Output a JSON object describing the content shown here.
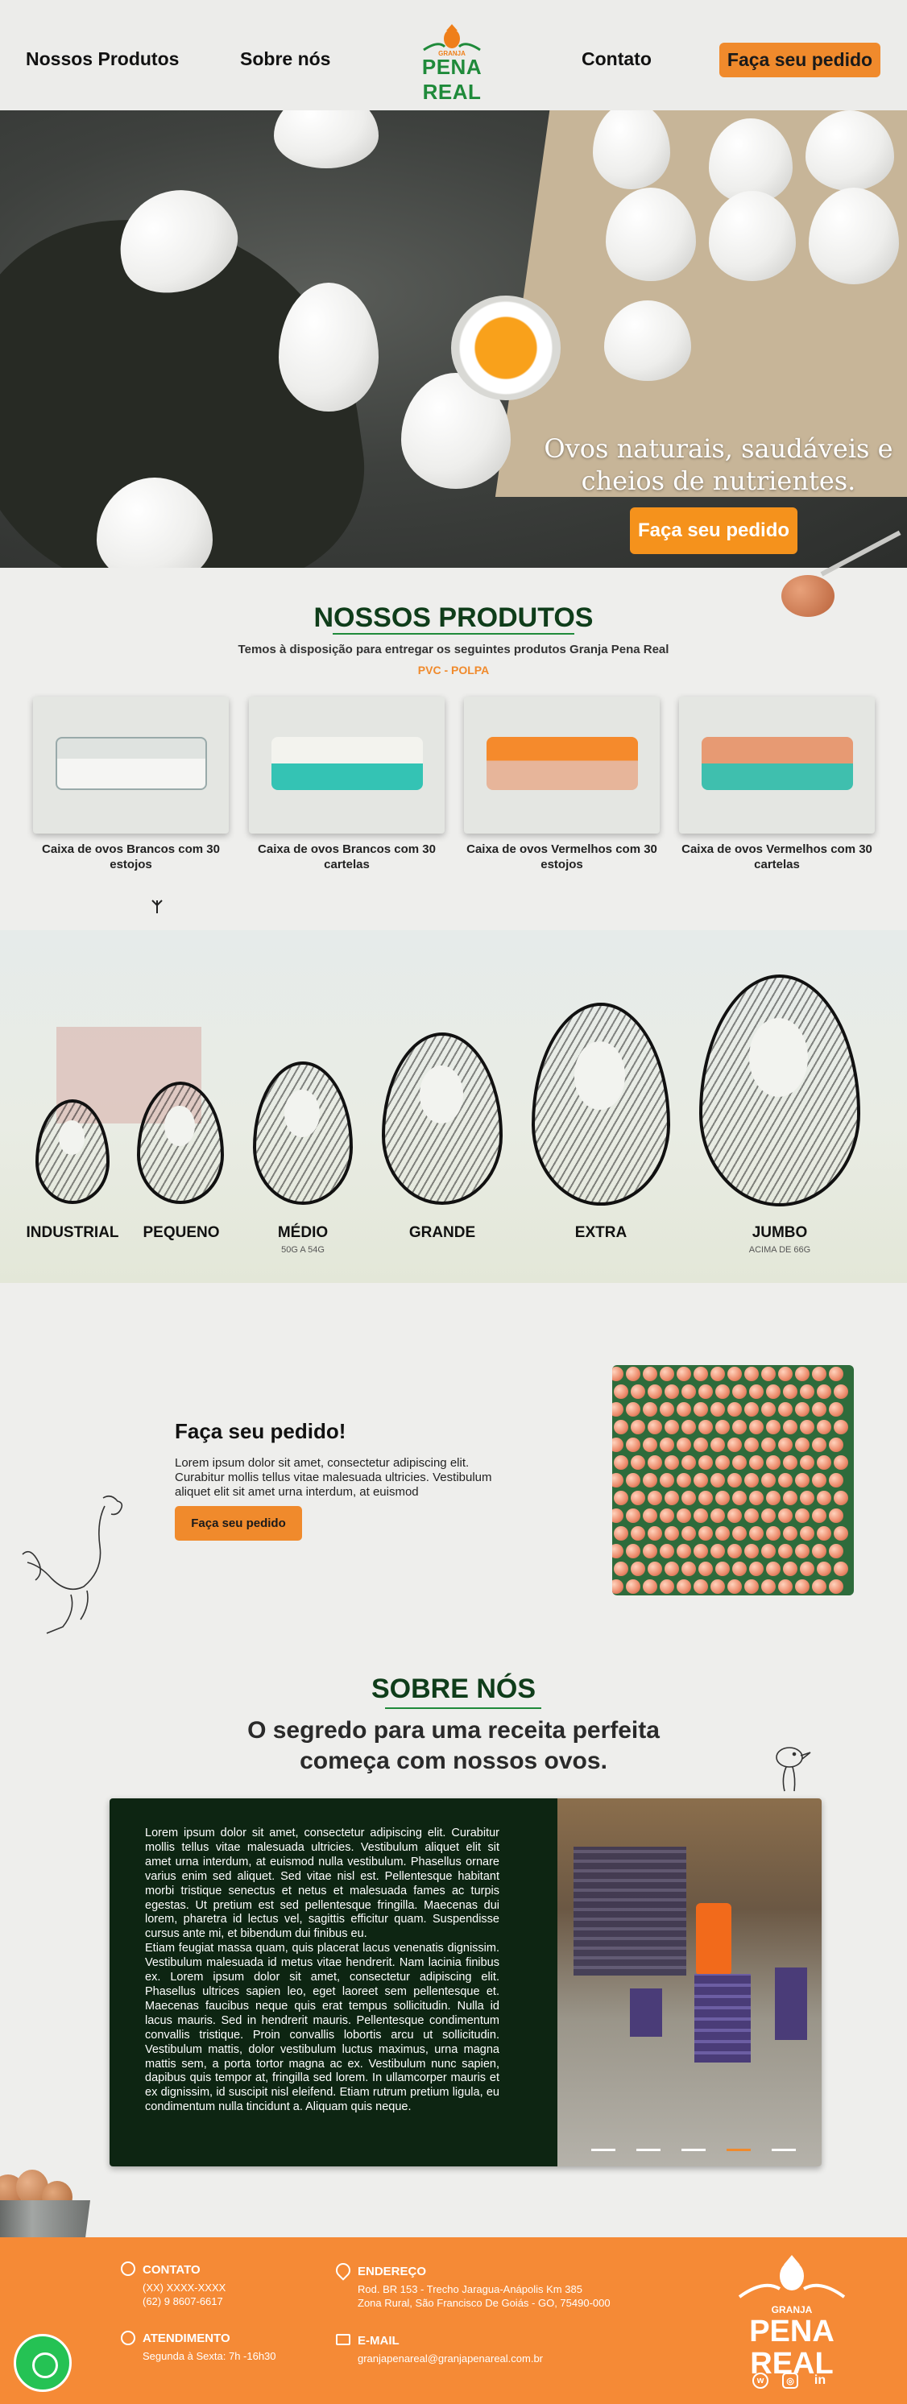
{
  "nav": {
    "produtos": "Nossos Produtos",
    "sobre": "Sobre nós",
    "contato": "Contato",
    "pedido": "Faça seu pedido"
  },
  "logo": {
    "granja": "GRANJA",
    "brand": "PENA REAL"
  },
  "hero": {
    "title": "Ovos naturais, saudáveis e cheios de nutrientes.",
    "button": "Faça seu pedido"
  },
  "produtos": {
    "title": "NOSSOS PRODUTOS",
    "subtitle": "Temos à disposição para entregar os seguintes produtos Granja Pena Real",
    "tag": "PVC - POLPA",
    "items": [
      {
        "label": "Caixa de ovos Brancos com 30 estojos"
      },
      {
        "label": "Caixa de ovos Brancos com 30 cartelas"
      },
      {
        "label": "Caixa de ovos Vermelhos com 30 estojos"
      },
      {
        "label": "Caixa de ovos Vermelhos com 30 cartelas"
      }
    ]
  },
  "tamanhos": [
    {
      "name": "INDUSTRIAL",
      "note": ""
    },
    {
      "name": "PEQUENO",
      "note": ""
    },
    {
      "name": "MÉDIO",
      "note": "50G A 54G"
    },
    {
      "name": "GRANDE",
      "note": ""
    },
    {
      "name": "EXTRA",
      "note": ""
    },
    {
      "name": "JUMBO",
      "note": "ACIMA DE 66G"
    }
  ],
  "pedido": {
    "title": "Faça seu pedido!",
    "text": "Lorem ipsum dolor sit amet, consectetur adipiscing elit. Curabitur mollis tellus vitae malesuada ultricies. Vestibulum aliquet elit sit amet urna interdum, at euismod",
    "button": "Faça seu pedido"
  },
  "sobre": {
    "title": "SOBRE NÓS",
    "subtitle_1": "O segredo para uma receita perfeita",
    "subtitle_2": "começa com nossos ovos.",
    "text": "Lorem ipsum dolor sit amet, consectetur adipiscing elit. Curabitur mollis tellus vitae malesuada ultricies. Vestibulum aliquet elit sit amet urna interdum, at euismod nulla vestibulum. Phasellus ornare varius enim sed aliquet. Sed vitae nisl est. Pellentesque habitant morbi tristique senectus et netus et malesuada fames ac turpis egestas. Ut pretium est sed pellentesque fringilla. Maecenas dui lorem, pharetra id lectus vel, sagittis efficitur quam. Suspendisse cursus ante mi, et bibendum dui finibus eu.",
    "text2": "Etiam feugiat massa quam, quis placerat lacus venenatis dignissim. Vestibulum malesuada id metus vitae hendrerit. Nam lacinia finibus ex. Lorem ipsum dolor sit amet, consectetur adipiscing elit. Phasellus ultrices sapien leo, eget laoreet sem pellentesque et. Maecenas faucibus neque quis erat tempus sollicitudin. Nulla id lacus mauris. Sed in hendrerit mauris. Pellentesque condimentum convallis tristique. Proin convallis lobortis arcu ut sollicitudin. Vestibulum mattis, dolor vestibulum luctus maximus, urna magna mattis sem, a porta tortor magna ac ex. Vestibulum nunc sapien, dapibus quis tempor at, fringilla sed lorem. In ullamcorper mauris et ex dignissim, id suscipit nisl eleifend. Etiam rutrum pretium ligula, eu condimentum nulla tincidunt a. Aliquam quis neque."
  },
  "footer": {
    "contato_h": "CONTATO",
    "contato_1": "(XX) XXXX-XXXX",
    "contato_2": "(62) 9 8607-6617",
    "atendimento_h": "ATENDIMENTO",
    "atendimento_1": "Segunda à Sexta: 7h -16h30",
    "endereco_h": "ENDEREÇO",
    "endereco_1": "Rod. BR 153 - Trecho Jaragua-Anápolis Km 385",
    "endereco_2": "Zona Rural, São Francisco De Goiás - GO, 75490-000",
    "email_h": "E-MAIL",
    "email_1": "granjapenareal@granjapenareal.com.br",
    "logo_granja": "GRANJA",
    "logo_brand": "PENA REAL"
  },
  "colors": {
    "accent": "#f08a2c",
    "green": "#1f8a3a",
    "dark": "#0d2512"
  }
}
